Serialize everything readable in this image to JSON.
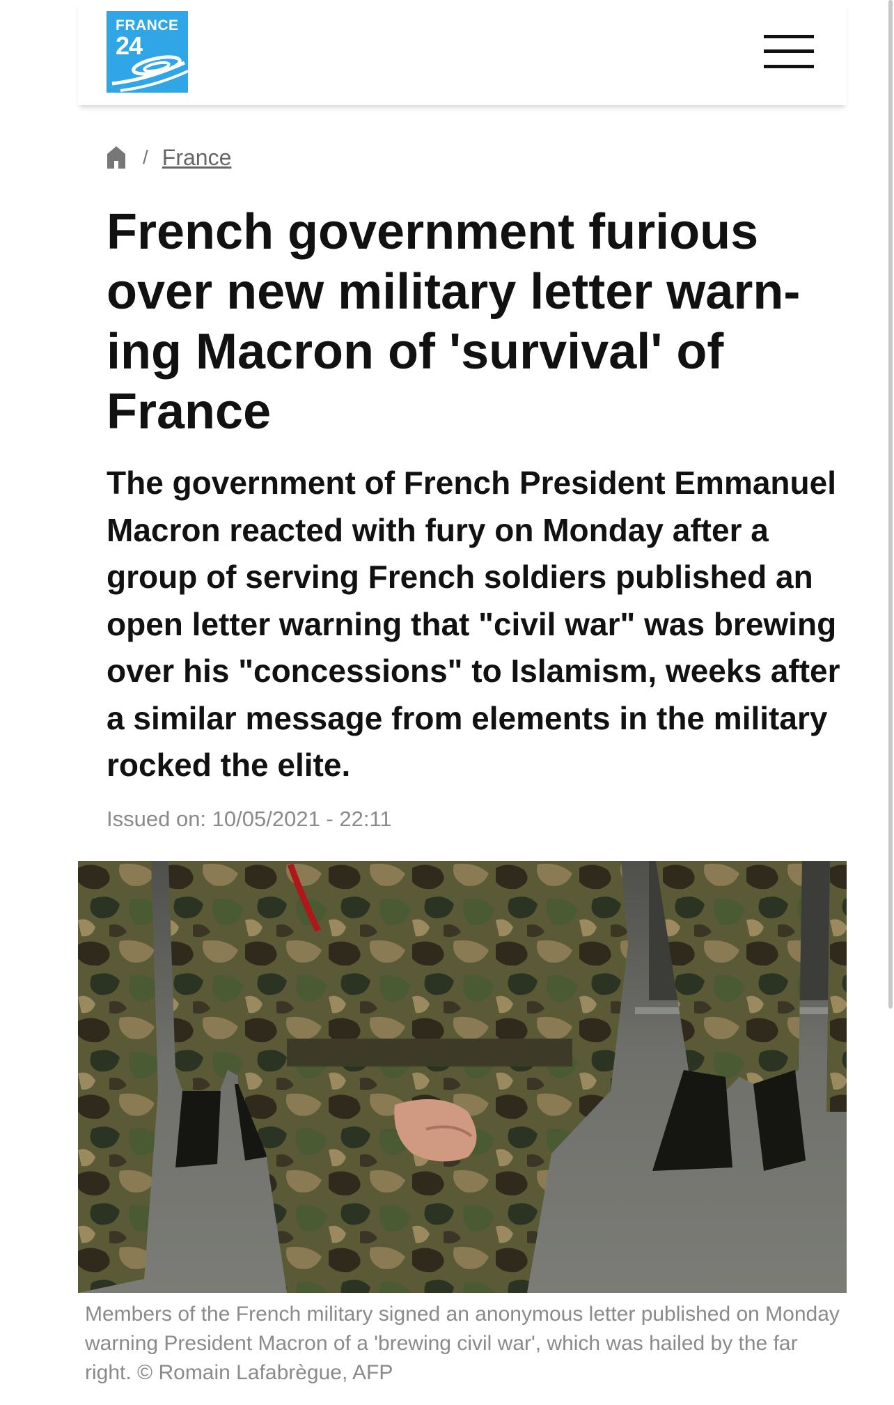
{
  "header": {
    "logo": {
      "word": "FRANCE",
      "number": "24",
      "color": "#30a6e6"
    },
    "menu_icon": "hamburger-icon"
  },
  "breadcrumb": {
    "home_icon": "home-icon",
    "separator": "/",
    "section": "France"
  },
  "article": {
    "title": "French government furious over new military letter warn-ing Macron of 'survival' of France",
    "lead": "The government of French President Emmanuel Macron reacted with fury on Monday after a group of serving French soldiers published an open letter warning that \"civil war\" was brewing over his \"concessions\" to Islamism, weeks after a similar message from elements in the military rocked the elite.",
    "issued": "Issued on: 10/05/2021 - 22:11",
    "caption": "Members of the French military signed an anonymous letter published on Monday warning President Macron of a 'brewing civil war', which was hailed by the far right. © Romain Lafabrègue, AFP"
  },
  "colors": {
    "brand": "#30a6e6",
    "text": "#111111",
    "muted": "#8a8a8a"
  }
}
